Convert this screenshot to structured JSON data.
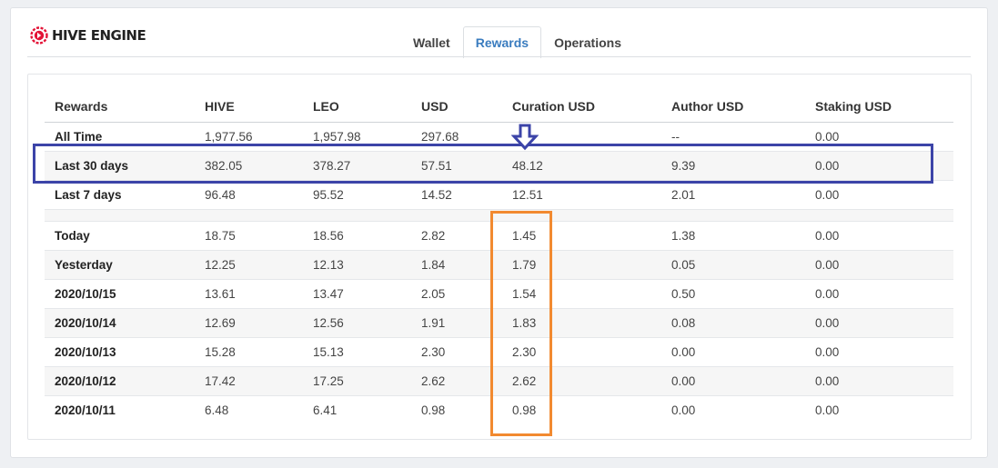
{
  "brand": {
    "name": "HIVE ENGINE",
    "logo_icon": "hive-engine-logo-icon",
    "logo_color": "#e31337"
  },
  "tabs": [
    {
      "label": "Wallet",
      "active": false
    },
    {
      "label": "Rewards",
      "active": true
    },
    {
      "label": "Operations",
      "active": false
    }
  ],
  "rewards_table": {
    "headers": [
      "Rewards",
      "HIVE",
      "LEO",
      "USD",
      "Curation USD",
      "Author USD",
      "Staking USD"
    ],
    "summary_rows": [
      [
        "All Time",
        "1,977.56",
        "1,957.98",
        "297.68",
        "",
        "--",
        "0.00"
      ],
      [
        "Last 30 days",
        "382.05",
        "378.27",
        "57.51",
        "48.12",
        "9.39",
        "0.00"
      ],
      [
        "Last 7 days",
        "96.48",
        "95.52",
        "14.52",
        "12.51",
        "2.01",
        "0.00"
      ]
    ],
    "daily_rows": [
      [
        "Today",
        "18.75",
        "18.56",
        "2.82",
        "1.45",
        "1.38",
        "0.00"
      ],
      [
        "Yesterday",
        "12.25",
        "12.13",
        "1.84",
        "1.79",
        "0.05",
        "0.00"
      ],
      [
        "2020/10/15",
        "13.61",
        "13.47",
        "2.05",
        "1.54",
        "0.50",
        "0.00"
      ],
      [
        "2020/10/14",
        "12.69",
        "12.56",
        "1.91",
        "1.83",
        "0.08",
        "0.00"
      ],
      [
        "2020/10/13",
        "15.28",
        "15.13",
        "2.30",
        "2.30",
        "0.00",
        "0.00"
      ],
      [
        "2020/10/12",
        "17.42",
        "17.25",
        "2.62",
        "2.62",
        "0.00",
        "0.00"
      ],
      [
        "2020/10/11",
        "6.48",
        "6.41",
        "0.98",
        "0.98",
        "0.00",
        "0.00"
      ]
    ]
  },
  "annotations": {
    "highlight_row_color": "#3c44a8",
    "highlight_column_color": "#f28a30",
    "arrow_icon": "down-arrow-icon",
    "arrow_color": "#3c44a8"
  }
}
